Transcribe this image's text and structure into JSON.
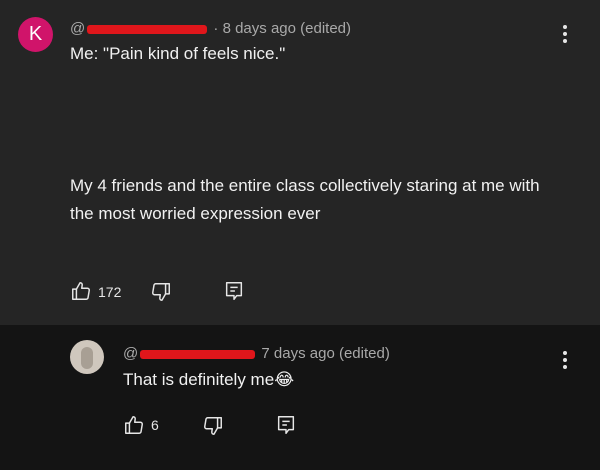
{
  "main_comment": {
    "avatar_letter": "K",
    "handle_prefix": "@",
    "timestamp": "8 days ago (edited)",
    "line1": "Me: \"Pain kind of feels nice.\"",
    "body": "My 4 friends and the entire class collectively staring at me with the most worried expression ever",
    "like_count": "172"
  },
  "reply_comment": {
    "handle_prefix": "@",
    "timestamp": "7 days ago (edited)",
    "text": "That is definitely me",
    "emoji": "😂",
    "like_count": "6"
  },
  "colors": {
    "avatar_bg": "#d0146a",
    "redaction": "#e0161b",
    "main_bg": "#252525",
    "reply_bg": "#141414"
  },
  "icons": [
    "thumbs-up-icon",
    "thumbs-down-icon",
    "reply-icon",
    "more-options-icon"
  ]
}
